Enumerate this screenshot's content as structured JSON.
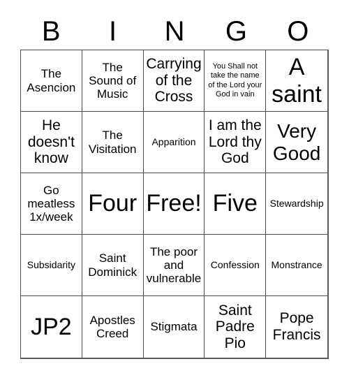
{
  "card": {
    "header_letters": [
      "B",
      "I",
      "N",
      "G",
      "O"
    ],
    "columns": 5,
    "rows": 5,
    "free_space_label": "Free!",
    "free_space_position": "center",
    "colors": {
      "background": "#ffffff",
      "text": "#000000",
      "grid_line": "#4d4d4d",
      "border": "#5a5a5a"
    },
    "cells": [
      {
        "text": "The Asencion",
        "size": "md",
        "row": 1,
        "col": 1,
        "free": false
      },
      {
        "text": "The Sound of Music",
        "size": "md",
        "row": 1,
        "col": 2,
        "free": false
      },
      {
        "text": "Carrying of the Cross",
        "size": "lg",
        "row": 1,
        "col": 3,
        "free": false
      },
      {
        "text": "You Shall not take the name of the Lord your God in vain",
        "size": "xs",
        "row": 1,
        "col": 4,
        "free": false
      },
      {
        "text": "A saint",
        "size": "xxl",
        "row": 1,
        "col": 5,
        "free": false
      },
      {
        "text": "He doesn't know",
        "size": "lg",
        "row": 2,
        "col": 1,
        "free": false
      },
      {
        "text": "The Visitation",
        "size": "md",
        "row": 2,
        "col": 2,
        "free": false
      },
      {
        "text": "Apparition",
        "size": "sm",
        "row": 2,
        "col": 3,
        "free": false
      },
      {
        "text": "I am the Lord thy God",
        "size": "lg",
        "row": 2,
        "col": 4,
        "free": false
      },
      {
        "text": "Very Good",
        "size": "xl",
        "row": 2,
        "col": 5,
        "free": false
      },
      {
        "text": "Go meatless 1x/week",
        "size": "md",
        "row": 3,
        "col": 1,
        "free": false
      },
      {
        "text": "Four",
        "size": "xxl",
        "row": 3,
        "col": 2,
        "free": false
      },
      {
        "text": "Free!",
        "size": "xxl",
        "row": 3,
        "col": 3,
        "free": true
      },
      {
        "text": "Five",
        "size": "xxl",
        "row": 3,
        "col": 4,
        "free": false
      },
      {
        "text": "Stewardship",
        "size": "sm",
        "row": 3,
        "col": 5,
        "free": false
      },
      {
        "text": "Subsidarity",
        "size": "sm",
        "row": 4,
        "col": 1,
        "free": false
      },
      {
        "text": "Saint Dominick",
        "size": "md",
        "row": 4,
        "col": 2,
        "free": false
      },
      {
        "text": "The poor and vulnerable",
        "size": "md",
        "row": 4,
        "col": 3,
        "free": false
      },
      {
        "text": "Confession",
        "size": "sm",
        "row": 4,
        "col": 4,
        "free": false
      },
      {
        "text": "Monstrance",
        "size": "sm",
        "row": 4,
        "col": 5,
        "free": false
      },
      {
        "text": "JP2",
        "size": "xxl",
        "row": 5,
        "col": 1,
        "free": false
      },
      {
        "text": "Apostles Creed",
        "size": "md",
        "row": 5,
        "col": 2,
        "free": false
      },
      {
        "text": "Stigmata",
        "size": "md",
        "row": 5,
        "col": 3,
        "free": false
      },
      {
        "text": "Saint Padre Pio",
        "size": "lg",
        "row": 5,
        "col": 4,
        "free": false
      },
      {
        "text": "Pope Francis",
        "size": "lg",
        "row": 5,
        "col": 5,
        "free": false
      }
    ]
  }
}
